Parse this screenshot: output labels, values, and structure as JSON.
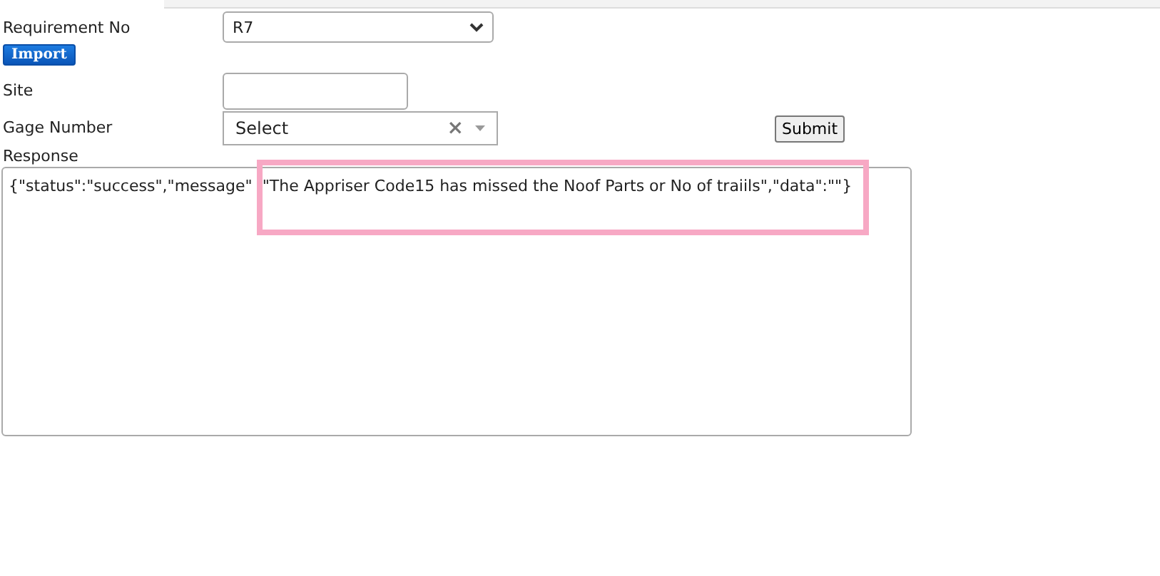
{
  "requirement_no": {
    "label": "Requirement No",
    "value": "R7"
  },
  "import_button": "Import",
  "site": {
    "label": "Site"
  },
  "gage_number": {
    "label": "Gage Number",
    "placeholder": "Select",
    "clear": "×"
  },
  "submit_button": "Submit",
  "response": {
    "label": "Response",
    "text": "{\"status\":\"success\",\"message\"",
    "highlighted_text": "\"The Appriser Code15 has missed the Noof Parts or No of traiils\",\"data\":\"\"}"
  }
}
